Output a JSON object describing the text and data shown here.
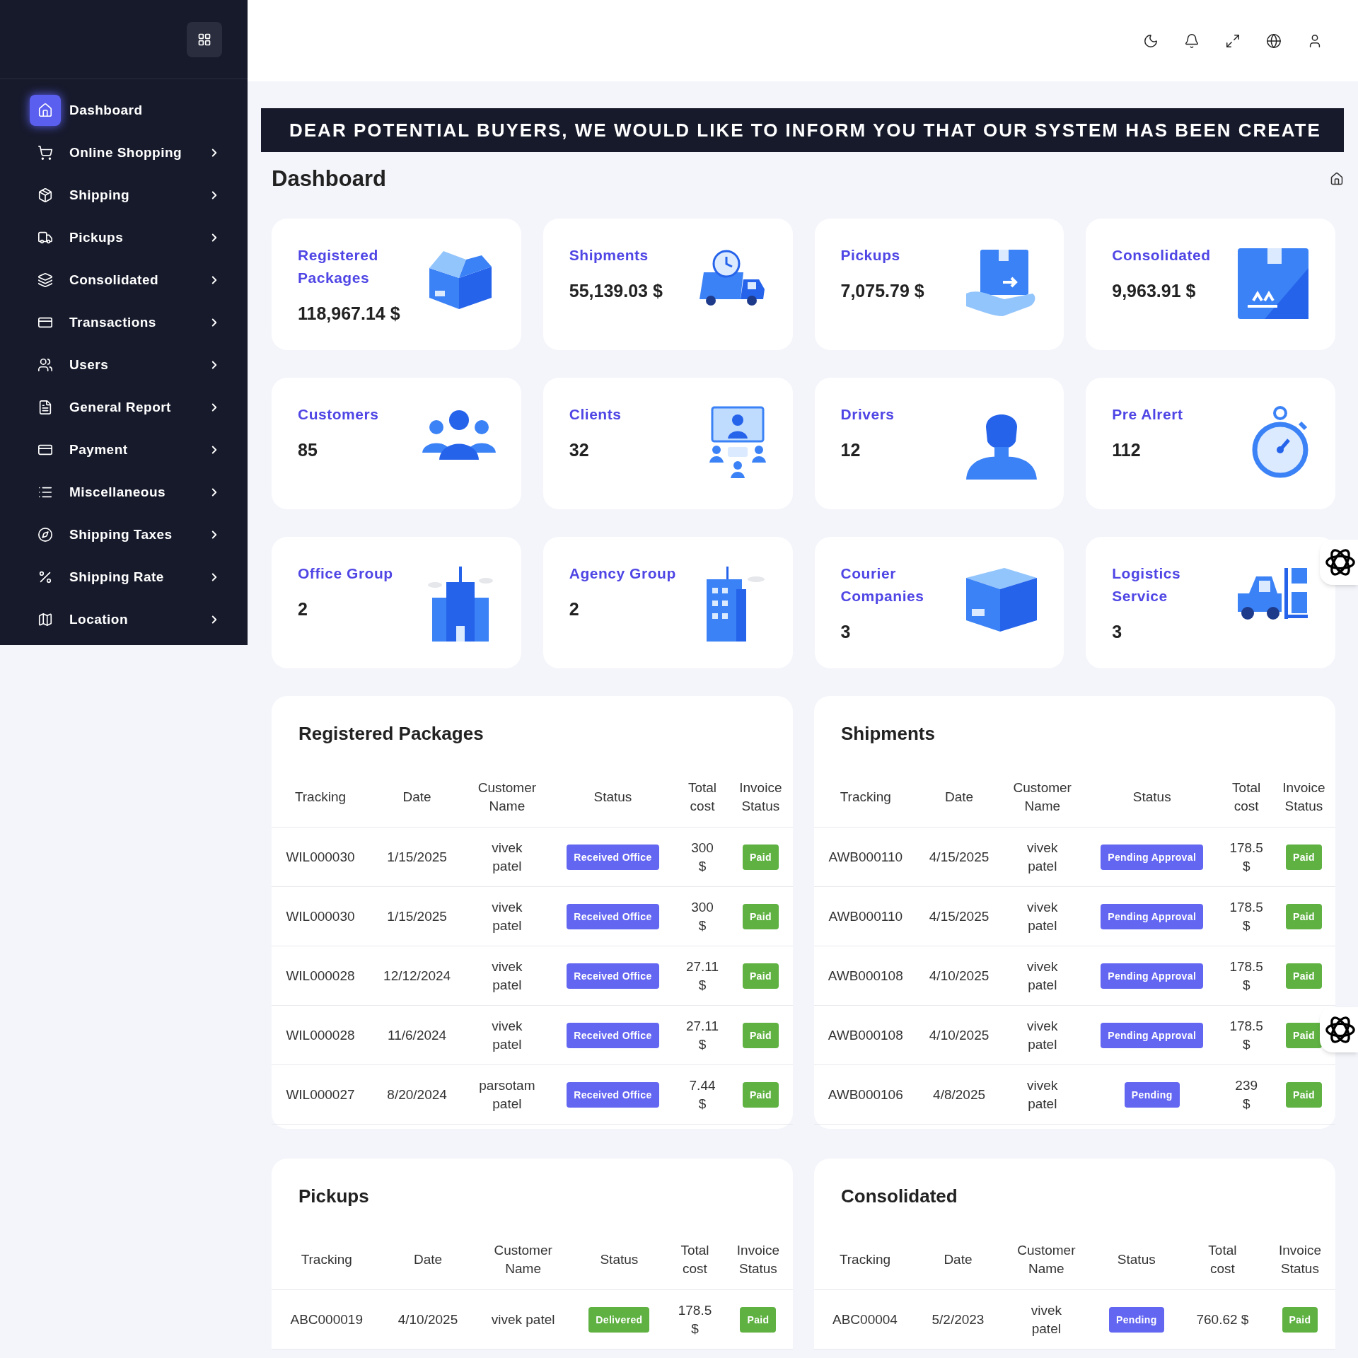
{
  "sidebar": {
    "items": [
      {
        "label": "Dashboard",
        "selected": true,
        "has_submenu": false
      },
      {
        "label": "Online Shopping",
        "selected": false,
        "has_submenu": true
      },
      {
        "label": "Shipping",
        "selected": false,
        "has_submenu": true
      },
      {
        "label": "Pickups",
        "selected": false,
        "has_submenu": true
      },
      {
        "label": "Consolidated",
        "selected": false,
        "has_submenu": true
      },
      {
        "label": "Transactions",
        "selected": false,
        "has_submenu": true
      },
      {
        "label": "Users",
        "selected": false,
        "has_submenu": true
      },
      {
        "label": "General Report",
        "selected": false,
        "has_submenu": true
      },
      {
        "label": "Payment",
        "selected": false,
        "has_submenu": true
      },
      {
        "label": "Miscellaneous",
        "selected": false,
        "has_submenu": true
      },
      {
        "label": "Shipping Taxes",
        "selected": false,
        "has_submenu": true
      },
      {
        "label": "Shipping Rate",
        "selected": false,
        "has_submenu": true
      },
      {
        "label": "Location",
        "selected": false,
        "has_submenu": true
      }
    ]
  },
  "banner": "DEAR POTENTIAL BUYERS, WE WOULD LIKE TO INFORM YOU THAT OUR SYSTEM HAS BEEN CREATE",
  "page_title": "Dashboard",
  "stat_cards": [
    {
      "title": "Registered Packages",
      "value": "118,967.14 $"
    },
    {
      "title": "Shipments",
      "value": "55,139.03 $"
    },
    {
      "title": "Pickups",
      "value": "7,075.79 $"
    },
    {
      "title": "Consolidated",
      "value": "9,963.91 $"
    },
    {
      "title": "Customers",
      "value": "85"
    },
    {
      "title": "Clients",
      "value": "32"
    },
    {
      "title": "Drivers",
      "value": "12"
    },
    {
      "title": "Pre Alrert",
      "value": "112"
    },
    {
      "title": "Office Group",
      "value": "2"
    },
    {
      "title": "Agency Group",
      "value": "2"
    },
    {
      "title": "Courier Companies",
      "value": "3"
    },
    {
      "title": "Logistics Service",
      "value": "3"
    }
  ],
  "tables": [
    {
      "title": "Registered Packages",
      "columns": [
        "Tracking",
        "Date",
        "Customer Name",
        "Status",
        "Total cost",
        "Invoice Status"
      ],
      "rows": [
        {
          "tracking": "WIL000030",
          "date": "1/15/2025",
          "customer": "vivek patel",
          "status": {
            "text": "Received Office",
            "color": "#6366f1"
          },
          "total": "300 $",
          "invoice": {
            "text": "Paid",
            "color": "#5fb142"
          }
        },
        {
          "tracking": "WIL000030",
          "date": "1/15/2025",
          "customer": "vivek patel",
          "status": {
            "text": "Received Office",
            "color": "#6366f1"
          },
          "total": "300 $",
          "invoice": {
            "text": "Paid",
            "color": "#5fb142"
          }
        },
        {
          "tracking": "WIL000028",
          "date": "12/12/2024",
          "customer": "vivek patel",
          "status": {
            "text": "Received Office",
            "color": "#6366f1"
          },
          "total": "27.11 $",
          "invoice": {
            "text": "Paid",
            "color": "#5fb142"
          }
        },
        {
          "tracking": "WIL000028",
          "date": "11/6/2024",
          "customer": "vivek patel",
          "status": {
            "text": "Received Office",
            "color": "#6366f1"
          },
          "total": "27.11 $",
          "invoice": {
            "text": "Paid",
            "color": "#5fb142"
          }
        },
        {
          "tracking": "WIL000027",
          "date": "8/20/2024",
          "customer": "parsotam patel",
          "status": {
            "text": "Received Office",
            "color": "#6366f1"
          },
          "total": "7.44 $",
          "invoice": {
            "text": "Paid",
            "color": "#5fb142"
          }
        }
      ]
    },
    {
      "title": "Shipments",
      "columns": [
        "Tracking",
        "Date",
        "Customer Name",
        "Status",
        "Total cost",
        "Invoice Status"
      ],
      "rows": [
        {
          "tracking": "AWB000110",
          "date": "4/15/2025",
          "customer": "vivek patel",
          "status": {
            "text": "Pending Approval",
            "color": "#6366f1"
          },
          "total": "178.5 $",
          "invoice": {
            "text": "Paid",
            "color": "#5fb142"
          }
        },
        {
          "tracking": "AWB000110",
          "date": "4/15/2025",
          "customer": "vivek patel",
          "status": {
            "text": "Pending Approval",
            "color": "#6366f1"
          },
          "total": "178.5 $",
          "invoice": {
            "text": "Paid",
            "color": "#5fb142"
          }
        },
        {
          "tracking": "AWB000108",
          "date": "4/10/2025",
          "customer": "vivek patel",
          "status": {
            "text": "Pending Approval",
            "color": "#6366f1"
          },
          "total": "178.5 $",
          "invoice": {
            "text": "Paid",
            "color": "#5fb142"
          }
        },
        {
          "tracking": "AWB000108",
          "date": "4/10/2025",
          "customer": "vivek patel",
          "status": {
            "text": "Pending Approval",
            "color": "#6366f1"
          },
          "total": "178.5 $",
          "invoice": {
            "text": "Paid",
            "color": "#5fb142"
          }
        },
        {
          "tracking": "AWB000106",
          "date": "4/8/2025",
          "customer": "vivek patel",
          "status": {
            "text": "Pending",
            "color": "#6366f1"
          },
          "total": "239 $",
          "invoice": {
            "text": "Paid",
            "color": "#5fb142"
          }
        }
      ]
    },
    {
      "title": "Pickups",
      "columns": [
        "Tracking",
        "Date",
        "Customer Name",
        "Status",
        "Total cost",
        "Invoice Status"
      ],
      "rows": [
        {
          "tracking": "ABC000019",
          "date": "4/10/2025",
          "customer": "vivek patel",
          "status": {
            "text": "Delivered",
            "color": "#5fb142"
          },
          "total": "178.5 $",
          "invoice": {
            "text": "Paid",
            "color": "#5fb142"
          }
        }
      ]
    },
    {
      "title": "Consolidated",
      "columns": [
        "Tracking",
        "Date",
        "Customer Name",
        "Status",
        "Total cost",
        "Invoice Status"
      ],
      "rows": [
        {
          "tracking": "ABC00004",
          "date": "5/2/2023",
          "customer": "vivek patel",
          "status": {
            "text": "Pending",
            "color": "#6366f1"
          },
          "total": "760.62 $",
          "invoice": {
            "text": "Paid",
            "color": "#5fb142"
          }
        }
      ]
    }
  ]
}
